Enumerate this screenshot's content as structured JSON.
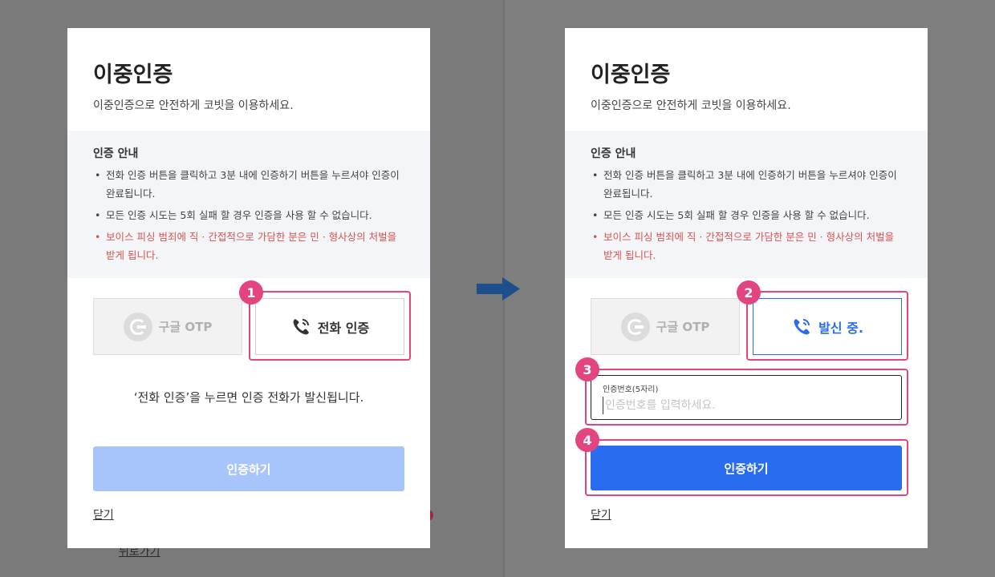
{
  "modal": {
    "title": "이중인증",
    "subtitle": "이중인증으로 안전하게 코빗을 이용하세요.",
    "guide_title": "인증 안내",
    "guide_items": [
      "전화 인증 버튼을 클릭하고 3분 내에 인증하기 버튼을 누르셔야 인증이 완료됩니다.",
      "모든 인증 시도는 5회 실패 할 경우 인증을 사용 할 수 없습니다.",
      "보이스 피싱 범죄에 직 · 간접적으로 가담한 분은 민 · 형사상의 처벌을 받게 됩니다."
    ],
    "option_otp": "구글 OTP",
    "option_phone": "전화 인증",
    "option_calling": "발신 중.",
    "notice": "‘전화 인증’을 누르면 인증 전화가 발신됩니다.",
    "code_label": "인증번호(5자리)",
    "code_placeholder": "인증번호를 입력하세요.",
    "verify_button": "인증하기",
    "close_link": "닫기"
  },
  "background": {
    "back_link": "뒤로가기"
  },
  "steps": [
    "1",
    "2",
    "3",
    "4"
  ],
  "icons": {
    "otp": "google-otp-icon",
    "phone": "phone-icon",
    "arrow": "right-arrow-icon"
  },
  "colors": {
    "accent": "#2a6cef",
    "disabled": "#a7c4fb",
    "highlight": "#e2457f",
    "warning": "#d9534f"
  }
}
